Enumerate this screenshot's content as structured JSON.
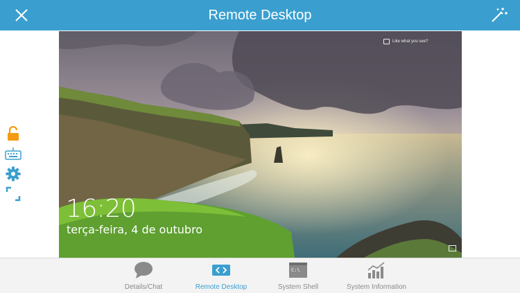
{
  "header": {
    "title": "Remote Desktop",
    "close_icon": "close-icon",
    "action_icon": "magic-wand-icon"
  },
  "side_tools": [
    {
      "name": "unlock-icon",
      "color": "#f39c12"
    },
    {
      "name": "keyboard-icon",
      "color": "#3a9fcf"
    },
    {
      "name": "gear-icon",
      "color": "#3a9fcf"
    },
    {
      "name": "fullscreen-icon",
      "color": "#3a9fcf"
    }
  ],
  "remote_screen": {
    "time": "16:20",
    "date": "terça-feira, 4 de outubro",
    "like_prompt": "Like what you see?"
  },
  "tabs": [
    {
      "label": "Details/Chat",
      "icon": "chat-bubble-icon",
      "active": false
    },
    {
      "label": "Remote Desktop",
      "icon": "remote-desktop-icon",
      "active": true
    },
    {
      "label": "System Shell",
      "icon": "terminal-icon",
      "active": false
    },
    {
      "label": "System Information",
      "icon": "bar-chart-icon",
      "active": false
    }
  ],
  "colors": {
    "accent": "#3a9fcf",
    "unlock": "#f39c12",
    "inactive": "#8a8a8a"
  }
}
